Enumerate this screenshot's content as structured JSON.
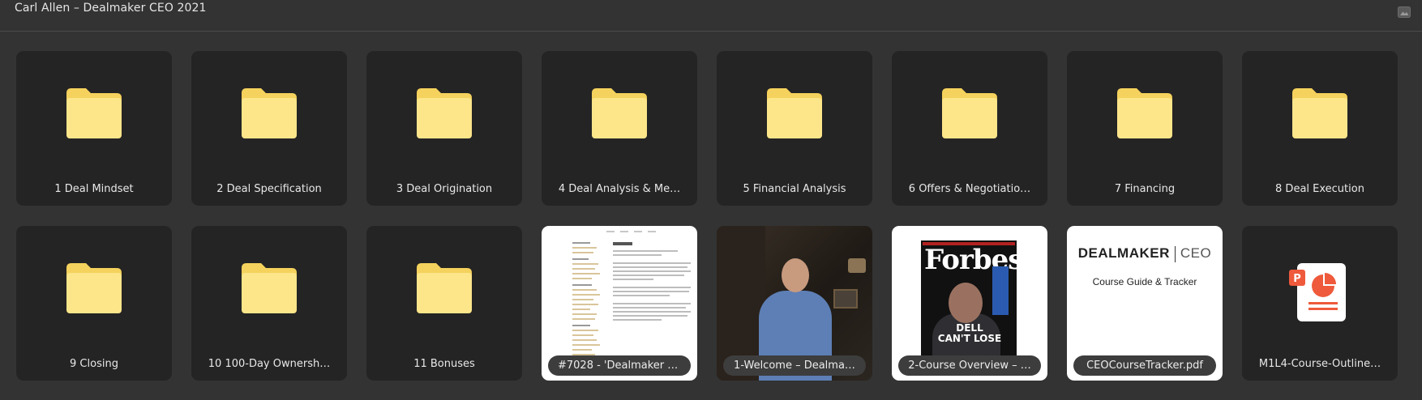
{
  "window": {
    "title": "Carl Allen – Dealmaker CEO 2021",
    "icon": "image-icon"
  },
  "colors": {
    "background": "#333333",
    "tile": "#242424",
    "folder": "#fde58a",
    "folder_tab": "#f5d25d",
    "pill": "#3d3d3d"
  },
  "items": [
    {
      "label": "1 Deal Mindset",
      "type": "folder"
    },
    {
      "label": "2 Deal Specification",
      "type": "folder"
    },
    {
      "label": "3 Deal Origination",
      "type": "folder"
    },
    {
      "label": "4 Deal Analysis & Me…",
      "type": "folder"
    },
    {
      "label": "5 Financial Analysis",
      "type": "folder"
    },
    {
      "label": "6 Offers & Negotiatio…",
      "type": "folder"
    },
    {
      "label": "7 Financing",
      "type": "folder"
    },
    {
      "label": "8 Deal Execution",
      "type": "folder"
    },
    {
      "label": "9 Closing",
      "type": "folder"
    },
    {
      "label": "10 100-Day Ownersh…",
      "type": "folder"
    },
    {
      "label": "11 Bonuses",
      "type": "folder"
    },
    {
      "label": "#7028 - 'Dealmaker C…",
      "type": "document"
    },
    {
      "label": "1-Welcome – Dealma…",
      "type": "video"
    },
    {
      "label": "2-Course Overview – …",
      "type": "image"
    },
    {
      "label": "CEOCourseTracker.pdf",
      "type": "pdf"
    },
    {
      "label": "M1L4-Course-Outline…",
      "type": "pptx"
    }
  ],
  "thumbs": {
    "magazine": {
      "logo": "Forbes",
      "headline_1": "DELL",
      "headline_2": "CAN'T LOSE"
    },
    "tracker": {
      "brand_left": "DEALMAKER",
      "brand_right": "CEO",
      "subtitle": "Course Guide & Tracker"
    },
    "pptx": {
      "letter": "P"
    }
  }
}
